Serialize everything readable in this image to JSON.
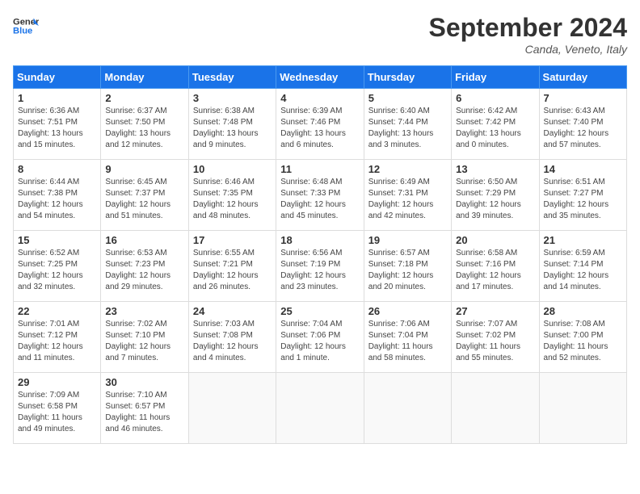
{
  "header": {
    "logo_line1": "General",
    "logo_line2": "Blue",
    "month_title": "September 2024",
    "location": "Canda, Veneto, Italy"
  },
  "weekdays": [
    "Sunday",
    "Monday",
    "Tuesday",
    "Wednesday",
    "Thursday",
    "Friday",
    "Saturday"
  ],
  "weeks": [
    [
      {
        "day": "1",
        "lines": [
          "Sunrise: 6:36 AM",
          "Sunset: 7:51 PM",
          "Daylight: 13 hours",
          "and 15 minutes."
        ]
      },
      {
        "day": "2",
        "lines": [
          "Sunrise: 6:37 AM",
          "Sunset: 7:50 PM",
          "Daylight: 13 hours",
          "and 12 minutes."
        ]
      },
      {
        "day": "3",
        "lines": [
          "Sunrise: 6:38 AM",
          "Sunset: 7:48 PM",
          "Daylight: 13 hours",
          "and 9 minutes."
        ]
      },
      {
        "day": "4",
        "lines": [
          "Sunrise: 6:39 AM",
          "Sunset: 7:46 PM",
          "Daylight: 13 hours",
          "and 6 minutes."
        ]
      },
      {
        "day": "5",
        "lines": [
          "Sunrise: 6:40 AM",
          "Sunset: 7:44 PM",
          "Daylight: 13 hours",
          "and 3 minutes."
        ]
      },
      {
        "day": "6",
        "lines": [
          "Sunrise: 6:42 AM",
          "Sunset: 7:42 PM",
          "Daylight: 13 hours",
          "and 0 minutes."
        ]
      },
      {
        "day": "7",
        "lines": [
          "Sunrise: 6:43 AM",
          "Sunset: 7:40 PM",
          "Daylight: 12 hours",
          "and 57 minutes."
        ]
      }
    ],
    [
      {
        "day": "8",
        "lines": [
          "Sunrise: 6:44 AM",
          "Sunset: 7:38 PM",
          "Daylight: 12 hours",
          "and 54 minutes."
        ]
      },
      {
        "day": "9",
        "lines": [
          "Sunrise: 6:45 AM",
          "Sunset: 7:37 PM",
          "Daylight: 12 hours",
          "and 51 minutes."
        ]
      },
      {
        "day": "10",
        "lines": [
          "Sunrise: 6:46 AM",
          "Sunset: 7:35 PM",
          "Daylight: 12 hours",
          "and 48 minutes."
        ]
      },
      {
        "day": "11",
        "lines": [
          "Sunrise: 6:48 AM",
          "Sunset: 7:33 PM",
          "Daylight: 12 hours",
          "and 45 minutes."
        ]
      },
      {
        "day": "12",
        "lines": [
          "Sunrise: 6:49 AM",
          "Sunset: 7:31 PM",
          "Daylight: 12 hours",
          "and 42 minutes."
        ]
      },
      {
        "day": "13",
        "lines": [
          "Sunrise: 6:50 AM",
          "Sunset: 7:29 PM",
          "Daylight: 12 hours",
          "and 39 minutes."
        ]
      },
      {
        "day": "14",
        "lines": [
          "Sunrise: 6:51 AM",
          "Sunset: 7:27 PM",
          "Daylight: 12 hours",
          "and 35 minutes."
        ]
      }
    ],
    [
      {
        "day": "15",
        "lines": [
          "Sunrise: 6:52 AM",
          "Sunset: 7:25 PM",
          "Daylight: 12 hours",
          "and 32 minutes."
        ]
      },
      {
        "day": "16",
        "lines": [
          "Sunrise: 6:53 AM",
          "Sunset: 7:23 PM",
          "Daylight: 12 hours",
          "and 29 minutes."
        ]
      },
      {
        "day": "17",
        "lines": [
          "Sunrise: 6:55 AM",
          "Sunset: 7:21 PM",
          "Daylight: 12 hours",
          "and 26 minutes."
        ]
      },
      {
        "day": "18",
        "lines": [
          "Sunrise: 6:56 AM",
          "Sunset: 7:19 PM",
          "Daylight: 12 hours",
          "and 23 minutes."
        ]
      },
      {
        "day": "19",
        "lines": [
          "Sunrise: 6:57 AM",
          "Sunset: 7:18 PM",
          "Daylight: 12 hours",
          "and 20 minutes."
        ]
      },
      {
        "day": "20",
        "lines": [
          "Sunrise: 6:58 AM",
          "Sunset: 7:16 PM",
          "Daylight: 12 hours",
          "and 17 minutes."
        ]
      },
      {
        "day": "21",
        "lines": [
          "Sunrise: 6:59 AM",
          "Sunset: 7:14 PM",
          "Daylight: 12 hours",
          "and 14 minutes."
        ]
      }
    ],
    [
      {
        "day": "22",
        "lines": [
          "Sunrise: 7:01 AM",
          "Sunset: 7:12 PM",
          "Daylight: 12 hours",
          "and 11 minutes."
        ]
      },
      {
        "day": "23",
        "lines": [
          "Sunrise: 7:02 AM",
          "Sunset: 7:10 PM",
          "Daylight: 12 hours",
          "and 7 minutes."
        ]
      },
      {
        "day": "24",
        "lines": [
          "Sunrise: 7:03 AM",
          "Sunset: 7:08 PM",
          "Daylight: 12 hours",
          "and 4 minutes."
        ]
      },
      {
        "day": "25",
        "lines": [
          "Sunrise: 7:04 AM",
          "Sunset: 7:06 PM",
          "Daylight: 12 hours",
          "and 1 minute."
        ]
      },
      {
        "day": "26",
        "lines": [
          "Sunrise: 7:06 AM",
          "Sunset: 7:04 PM",
          "Daylight: 11 hours",
          "and 58 minutes."
        ]
      },
      {
        "day": "27",
        "lines": [
          "Sunrise: 7:07 AM",
          "Sunset: 7:02 PM",
          "Daylight: 11 hours",
          "and 55 minutes."
        ]
      },
      {
        "day": "28",
        "lines": [
          "Sunrise: 7:08 AM",
          "Sunset: 7:00 PM",
          "Daylight: 11 hours",
          "and 52 minutes."
        ]
      }
    ],
    [
      {
        "day": "29",
        "lines": [
          "Sunrise: 7:09 AM",
          "Sunset: 6:58 PM",
          "Daylight: 11 hours",
          "and 49 minutes."
        ]
      },
      {
        "day": "30",
        "lines": [
          "Sunrise: 7:10 AM",
          "Sunset: 6:57 PM",
          "Daylight: 11 hours",
          "and 46 minutes."
        ]
      },
      null,
      null,
      null,
      null,
      null
    ]
  ]
}
